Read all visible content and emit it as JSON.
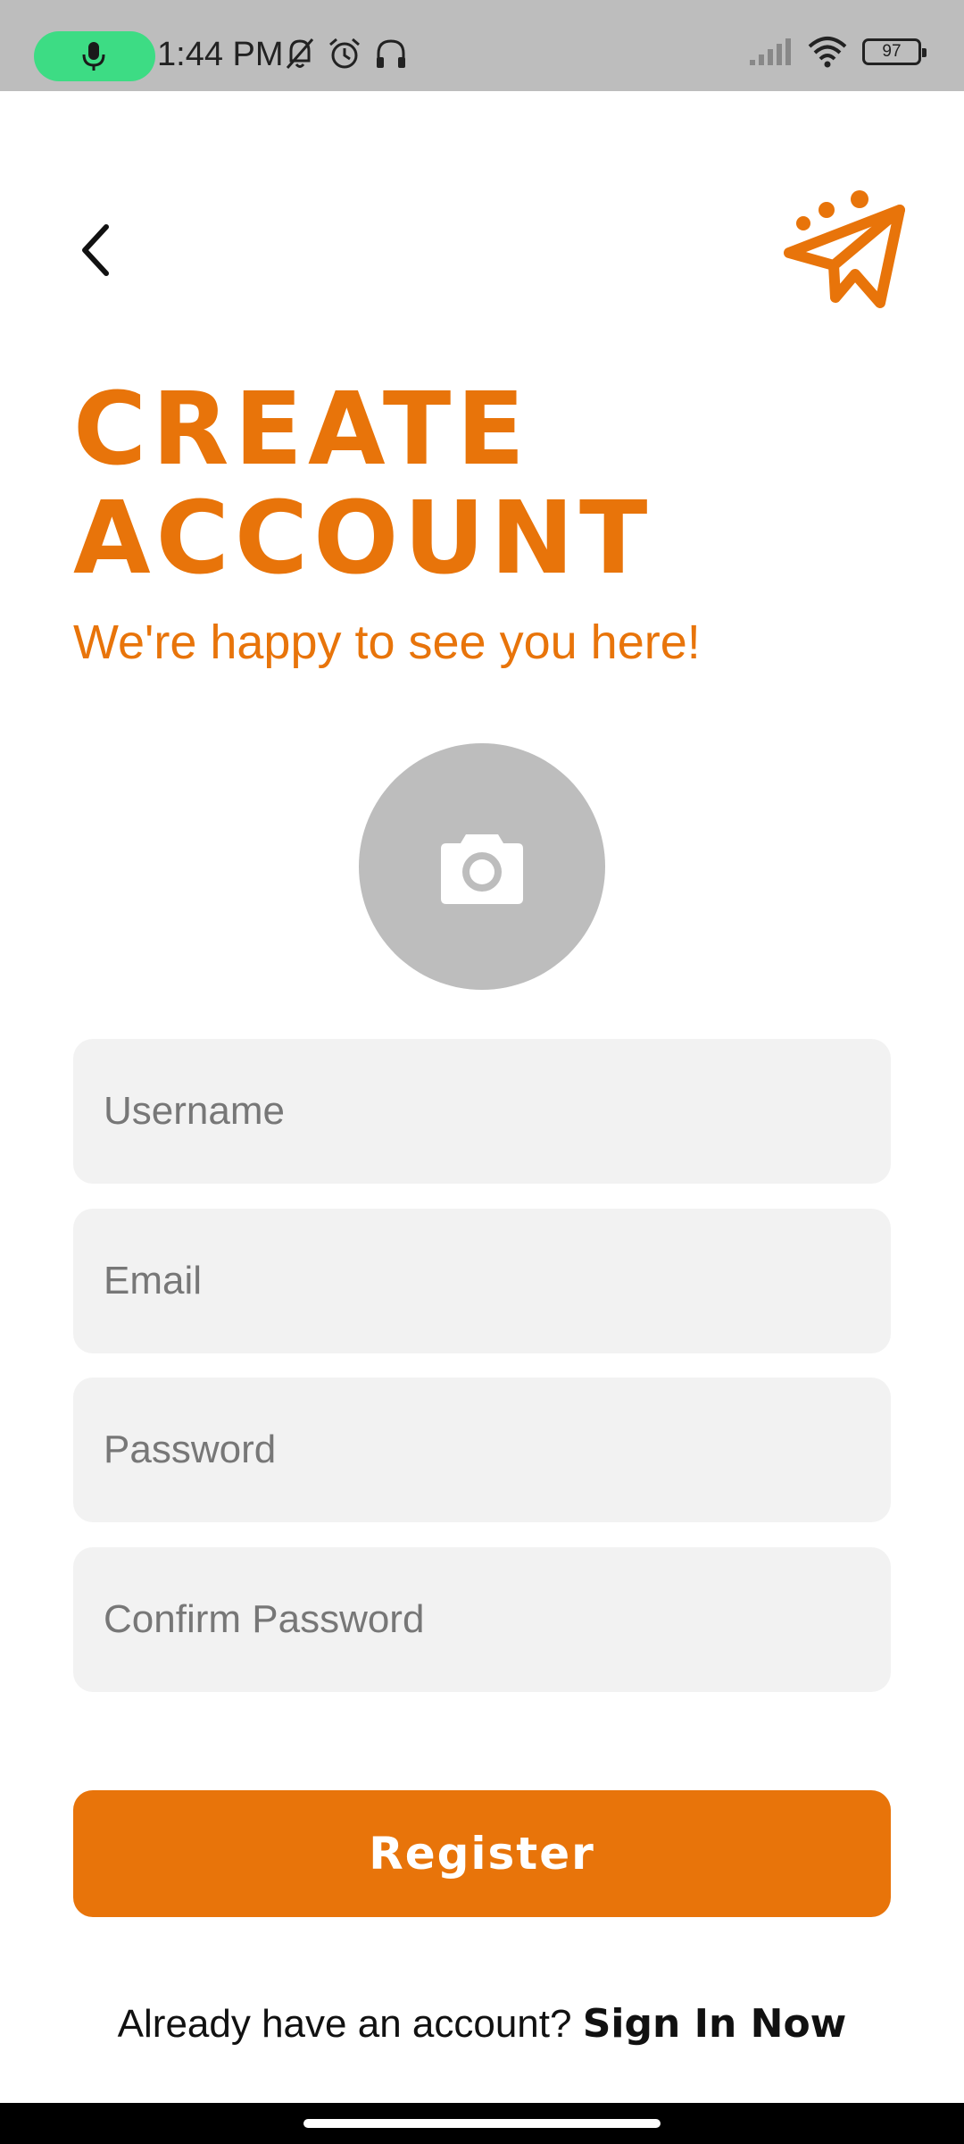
{
  "status_bar": {
    "time": "1:44 PM",
    "battery": "97",
    "icons": [
      "mic-icon",
      "bell-off-icon",
      "alarm-icon",
      "headphones-icon",
      "signal-icon",
      "wifi-icon",
      "battery-icon"
    ],
    "pill_color": "#3ddc84"
  },
  "header": {
    "back_icon": "chevron-left-icon",
    "logo_icon": "paper-plane-logo-icon"
  },
  "title": {
    "line1": "CREATE",
    "line2": "ACCOUNT",
    "subtitle": "We're happy to see you here!"
  },
  "avatar": {
    "icon": "camera-icon"
  },
  "form": {
    "username_placeholder": "Username",
    "email_placeholder": "Email",
    "password_placeholder": "Password",
    "confirm_password_placeholder": "Confirm Password"
  },
  "register_button": "Register",
  "footer": {
    "prompt": "Already have an account? ",
    "link": "Sign In Now"
  },
  "colors": {
    "accent": "#e8740a",
    "field_bg": "#f2f2f2",
    "avatar_bg": "#bdbdbd"
  }
}
